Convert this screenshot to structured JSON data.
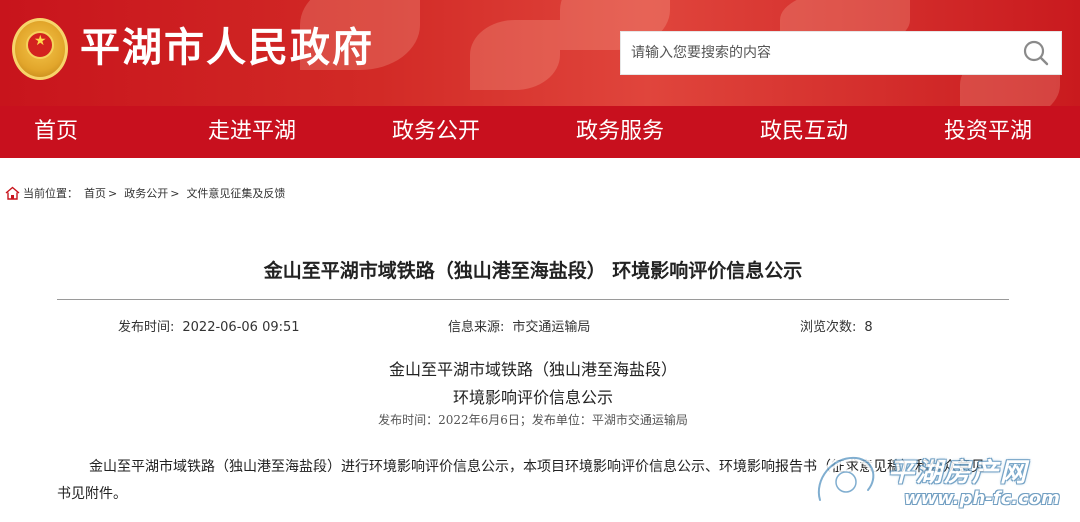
{
  "header": {
    "site_title": "平湖市人民政府",
    "search": {
      "placeholder": "请输入您要搜索的内容",
      "value": ""
    },
    "colors": {
      "banner_red": "#c8141c",
      "nav_red": "#c8101e",
      "emblem_gold": "#f4c54a"
    },
    "icons": {
      "emblem": "national-emblem-icon",
      "search": "search-icon"
    }
  },
  "nav": {
    "items": [
      "首页",
      "走进平湖",
      "政务公开",
      "政务服务",
      "政民互动",
      "投资平湖"
    ]
  },
  "breadcrumb": {
    "label": "当前位置：",
    "items": [
      "首页",
      "政务公开",
      "文件意见征集及反馈"
    ],
    "separator": ">",
    "icon": "home-icon"
  },
  "article": {
    "title": "金山至平湖市域铁路（独山港至海盐段） 环境影响评价信息公示",
    "meta": {
      "publish_label": "发布时间:",
      "publish_value": "2022-06-06 09:51",
      "source_label": "信息来源:",
      "source_value": "市交通运输局",
      "views_label": "浏览次数:",
      "views_value": "8"
    },
    "subtitle_line1": "金山至平湖市域铁路（独山港至海盐段）",
    "subtitle_line2": "环境影响评价信息公示",
    "pub_line": "发布时间：2022年6月6日；发布单位：平湖市交通运输局",
    "body": "金山至平湖市域铁路（独山港至海盐段）进行环境影响评价信息公示，本项目环境影响评价信息公示、环境影响报告书（征求意见稿）和公众意见书见附件。"
  },
  "watermark": {
    "text": "平湖房产网",
    "url": "www.ph-fc.com",
    "icon": "ph-fc-logo-icon"
  }
}
